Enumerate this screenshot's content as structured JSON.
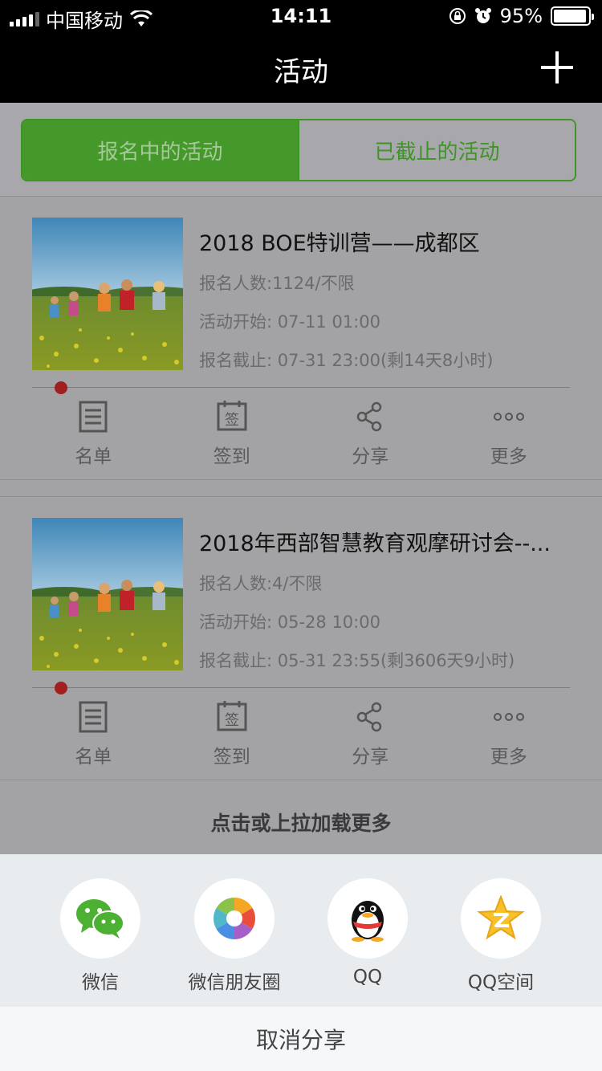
{
  "status_bar": {
    "carrier": "中国移动",
    "time": "14:11",
    "battery_percent": "95%",
    "battery_level": 0.95
  },
  "nav": {
    "title": "活动",
    "add_icon": "plus-icon"
  },
  "tabs": [
    {
      "label": "报名中的活动",
      "active": true
    },
    {
      "label": "已截止的活动",
      "active": false
    }
  ],
  "activities": [
    {
      "title": "2018 BOE特训营——成都区",
      "signups": "报名人数:1124/不限",
      "start": "活动开始: 07-11 01:00",
      "deadline": "报名截止: 07-31 23:00(剩14天8小时)",
      "actions": {
        "list": "名单",
        "checkin": "签到",
        "checkin_glyph": "签",
        "share": "分享",
        "more": "更多"
      }
    },
    {
      "title": "2018年西部智慧教育观摩研讨会--...",
      "signups": "报名人数:4/不限",
      "start": "活动开始: 05-28 10:00",
      "deadline": "报名截止: 05-31 23:55(剩3606天9小时)",
      "actions": {
        "list": "名单",
        "checkin": "签到",
        "checkin_glyph": "签",
        "share": "分享",
        "more": "更多"
      }
    }
  ],
  "load_more": "点击或上拉加载更多",
  "share_sheet": {
    "options": [
      {
        "label": "微信",
        "icon": "wechat-icon"
      },
      {
        "label": "微信朋友圈",
        "icon": "moments-icon"
      },
      {
        "label": "QQ",
        "icon": "qq-icon"
      },
      {
        "label": "QQ空间",
        "icon": "qzone-icon"
      }
    ],
    "cancel": "取消分享"
  },
  "colors": {
    "accent": "#45992b",
    "badge": "#a11f1f"
  }
}
